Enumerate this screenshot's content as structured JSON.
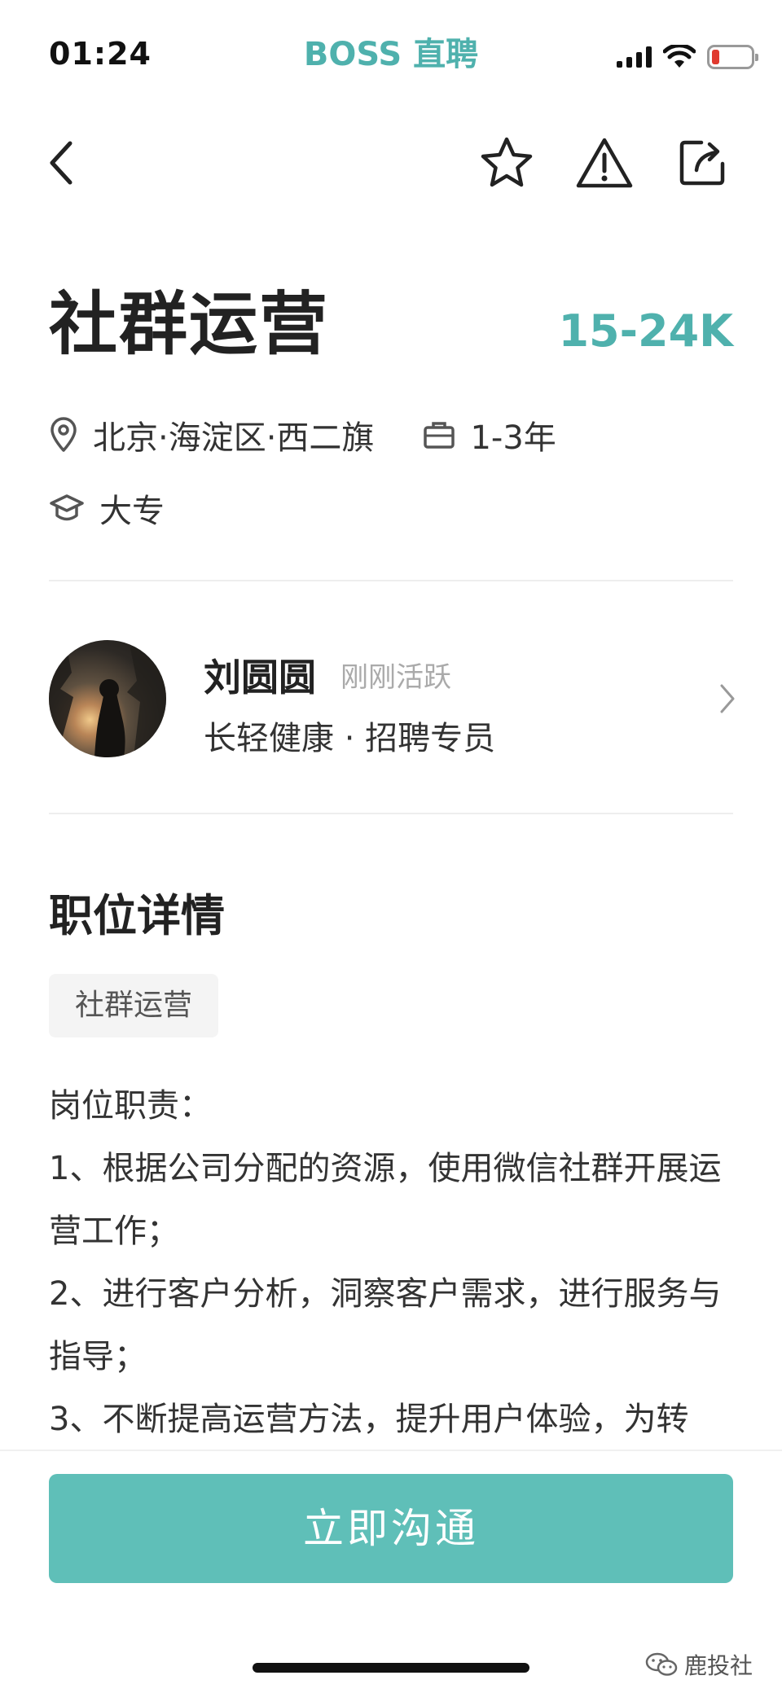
{
  "status_bar": {
    "time": "01:24",
    "carrier": "BOSS 直聘"
  },
  "nav": {
    "back_icon": "chevron-left-icon",
    "favorite_icon": "star-outline-icon",
    "report_icon": "warning-triangle-icon",
    "share_icon": "share-icon"
  },
  "job": {
    "title": "社群运营",
    "salary": "15-24K",
    "location": "北京·海淀区·西二旗",
    "experience": "1-3年",
    "education": "大专"
  },
  "recruiter": {
    "name": "刘圆圆",
    "status": "刚刚活跃",
    "company_role": "长轻健康 · 招聘专员"
  },
  "details": {
    "section_title": "职位详情",
    "tag": "社群运营",
    "description": [
      "岗位职责：",
      "1、根据公司分配的资源，使用微信社群开展运营工作；",
      "2、进行客户分析，洞察客户需求，进行服务与指导；",
      "3、不断提高运营方法，提升用户体验，为转"
    ]
  },
  "cta": {
    "label": "立即沟通"
  },
  "watermark": {
    "text": "鹿投社"
  },
  "colors": {
    "accent": "#4fb1ad",
    "button": "#5fbfb8"
  }
}
